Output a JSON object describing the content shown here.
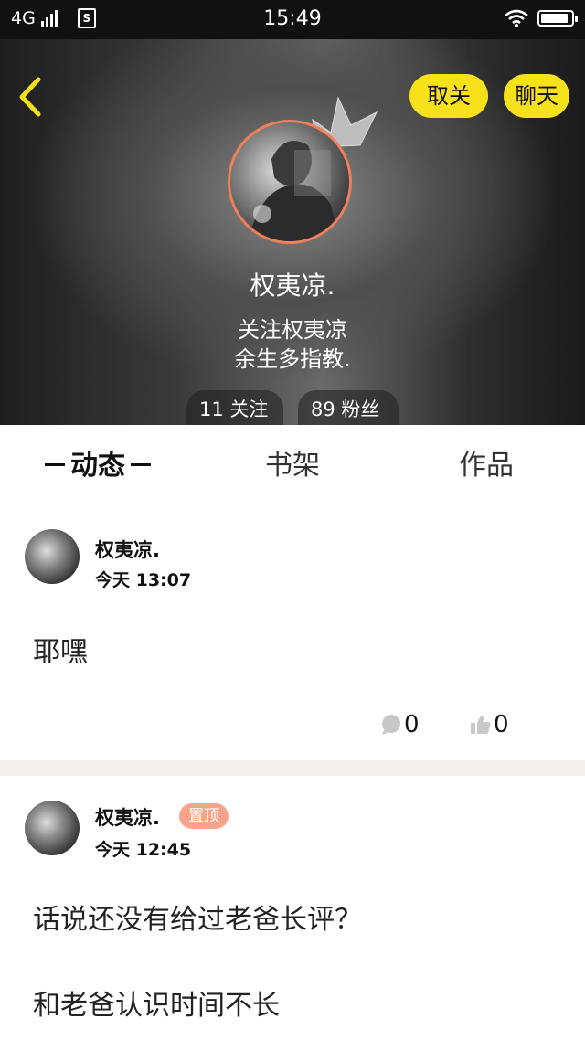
{
  "status_bar": {
    "network": "4G",
    "sim_icon": "sim-card-icon",
    "time": "15:49",
    "wifi_icon": "wifi-icon",
    "battery_level": 0.9
  },
  "header": {
    "back_icon": "chevron-left-icon",
    "unfollow_label": "取关",
    "chat_label": "聊天",
    "accent_color": "#f7e11b"
  },
  "profile": {
    "name": "权夷凉.",
    "bio_line1": "关注权夷凉",
    "bio_line2": "余生多指教.",
    "following": "11 关注",
    "fans": "89 粉丝",
    "avatar_border_color": "#f0805a"
  },
  "tabs": [
    {
      "label": "动态",
      "active": true
    },
    {
      "label": "书架",
      "active": false
    },
    {
      "label": "作品",
      "active": false
    }
  ],
  "posts": [
    {
      "author": "权夷凉.",
      "time": "今天 13:07",
      "text": "耶嘿",
      "comment_count": "0",
      "like_count": "0"
    },
    {
      "author": "权夷凉.",
      "pinned_label": "置顶",
      "time": "今天 12:45",
      "text_line1": "话说还没有给过老爸长评？",
      "text_line2": "和老爸认识时间不长"
    }
  ]
}
